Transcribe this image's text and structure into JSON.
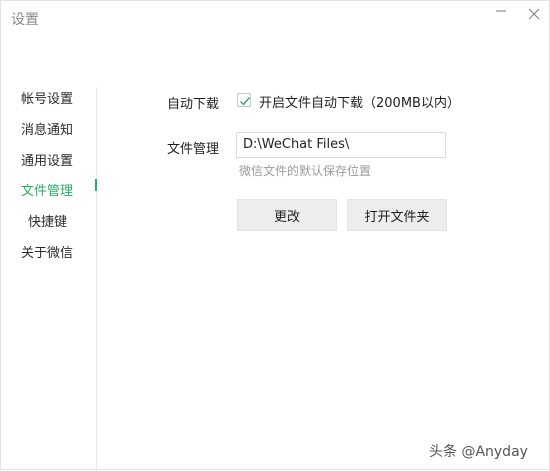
{
  "window": {
    "title": "设置",
    "minimize_icon": "minimize-icon",
    "close_icon": "close-icon"
  },
  "sidebar": {
    "items": [
      {
        "label": "帐号设置"
      },
      {
        "label": "消息通知"
      },
      {
        "label": "通用设置"
      },
      {
        "label": "文件管理",
        "active": true
      },
      {
        "label": "快捷键"
      },
      {
        "label": "关于微信"
      }
    ],
    "active_color": "#2aae67"
  },
  "main": {
    "auto_download_label": "自动下载",
    "auto_download_checkbox_label": "开启文件自动下载（200MB以内）",
    "auto_download_checked": true,
    "file_manage_label": "文件管理",
    "path_value": "D:\\WeChat Files\\",
    "path_hint": "微信文件的默认保存位置",
    "change_button": "更改",
    "open_folder_button": "打开文件夹"
  },
  "watermark": {
    "text": "头条 @Anyday"
  }
}
